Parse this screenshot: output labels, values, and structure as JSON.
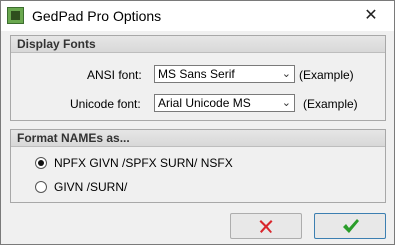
{
  "window": {
    "title": "GedPad Pro Options",
    "close_glyph": "✕",
    "app_icon": "gedpad-app-icon"
  },
  "display_fonts": {
    "heading": "Display Fonts",
    "ansi": {
      "label": "ANSI font:",
      "value": "MS Sans Serif",
      "example": "(Example)"
    },
    "unicode": {
      "label": "Unicode font:",
      "value": "Arial Unicode MS",
      "example": "(Example)"
    }
  },
  "format_names": {
    "heading": "Format NAMEs as...",
    "options": [
      {
        "label": "NPFX GIVN /SPFX SURN/ NSFX",
        "selected": true
      },
      {
        "label": "GIVN /SURN/",
        "selected": false
      }
    ]
  },
  "buttons": {
    "cancel_icon": "red-x-icon",
    "ok_icon": "green-check-icon",
    "cancel_color": "#d9262c",
    "ok_color": "#2a9d2a"
  },
  "dropdown_arrow": "⌄"
}
